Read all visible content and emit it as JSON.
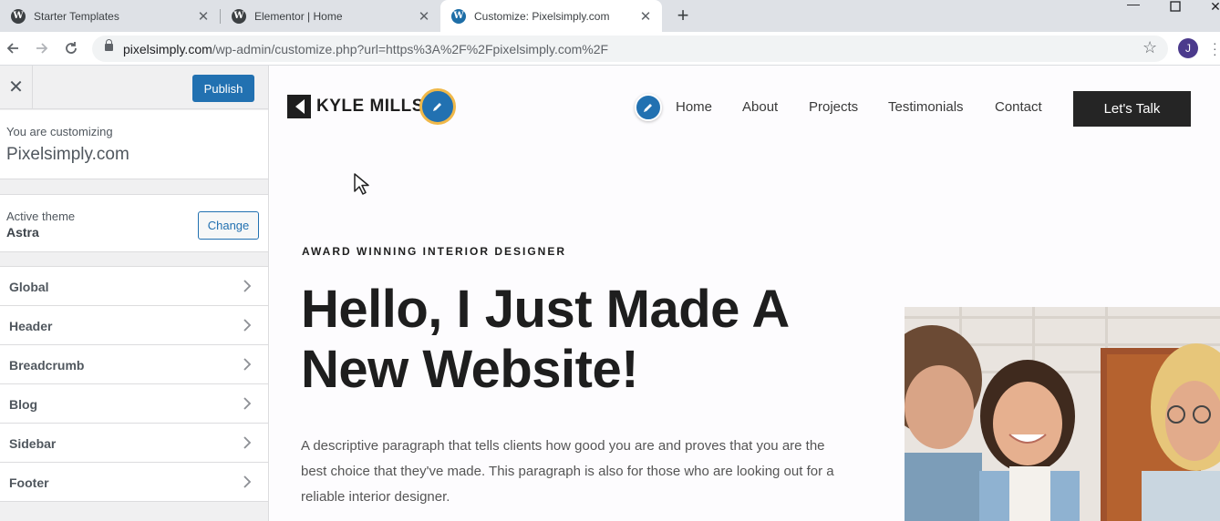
{
  "browser": {
    "tabs": [
      {
        "title": "Starter Templates",
        "active": false
      },
      {
        "title": "Elementor | Home",
        "active": false
      },
      {
        "title": "Customize: Pixelsimply.com",
        "active": true
      }
    ],
    "url_host": "pixelsimply.com",
    "url_path": "/wp-admin/customize.php?url=https%3A%2F%2Fpixelsimply.com%2F",
    "profile_initial": "J",
    "icons": [
      "wordpress-icon",
      "close-icon",
      "new-tab-icon",
      "minimize-icon",
      "maximize-icon",
      "back-icon",
      "forward-icon",
      "reload-icon",
      "lock-icon",
      "star-icon",
      "menu-icon"
    ]
  },
  "customizer": {
    "publish_label": "Publish",
    "customizing_label": "You are customizing",
    "site_name": "Pixelsimply.com",
    "active_theme_label": "Active theme",
    "theme_name": "Astra",
    "change_label": "Change",
    "sections": [
      "Global",
      "Header",
      "Breadcrumb",
      "Blog",
      "Sidebar",
      "Footer"
    ],
    "accent_color": "#2271b1"
  },
  "site": {
    "logo_text": "KYLE MILLS",
    "nav": [
      "Home",
      "About",
      "Projects",
      "Testimonials",
      "Contact"
    ],
    "cta_label": "Let's Talk",
    "eyebrow": "AWARD WINNING INTERIOR DESIGNER",
    "headline": "Hello, I Just Made A New Website!",
    "paragraph": "A descriptive paragraph that tells clients how good you are and proves that you are the best choice that they've made. This paragraph is also for those who are looking out for a reliable interior designer.",
    "edit_ring_color": "#f0b849",
    "dark_color": "#252525"
  }
}
